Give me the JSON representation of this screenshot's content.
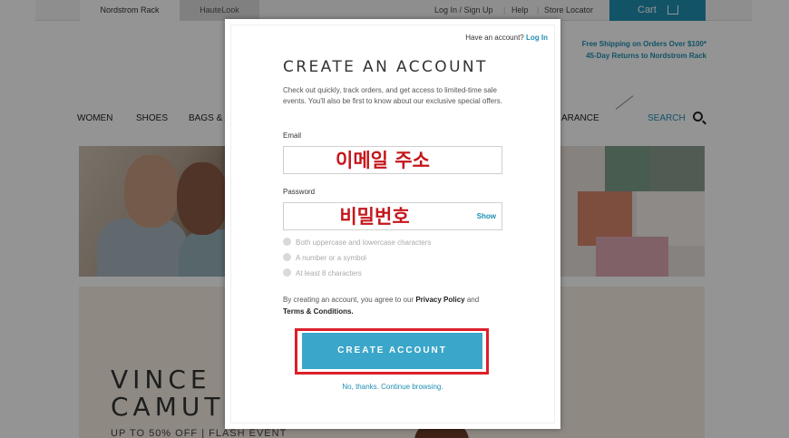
{
  "topbar": {
    "tabs": [
      "Nordstrom Rack",
      "HauteLook"
    ],
    "login": "Log In / Sign Up",
    "help": "Help",
    "store_locator": "Store Locator",
    "cart": "Cart"
  },
  "promo": {
    "line1": "Free Shipping on Orders Over $100*",
    "line2": "45-Day Returns to Nordstrom Rack"
  },
  "nav": {
    "items": [
      "WOMEN",
      "SHOES",
      "BAGS & A",
      "ARANCE"
    ],
    "search": "SEARCH"
  },
  "banner2": {
    "title_line1": "VINCE",
    "title_line2": "CAMUT",
    "subtitle": "UP TO 50% OFF | FLASH EVENT"
  },
  "modal": {
    "have_account_text": "Have an account?",
    "login_link": "Log In",
    "title": "CREATE AN ACCOUNT",
    "description": "Check out quickly, track orders, and get access to limited-time sale events. You'll also be first to know about our exclusive special offers.",
    "email_label": "Email",
    "email_annotation": "이메일 주소",
    "password_label": "Password",
    "password_annotation": "비밀번호",
    "show_label": "Show",
    "requirements": [
      "Both uppercase and lowercase characters",
      "A number or a symbol",
      "At least 8 characters"
    ],
    "terms_prefix": "By creating an account, you agree to our",
    "privacy_policy": "Privacy Policy",
    "terms_and": "and",
    "terms_conditions": "Terms & Conditions.",
    "create_button": "CREATE ACCOUNT",
    "no_thanks": "No, thanks. Continue browsing."
  },
  "colors": {
    "accent": "#1f8fb3",
    "button": "#3aa6c9",
    "annotation_red": "#c4161c"
  }
}
